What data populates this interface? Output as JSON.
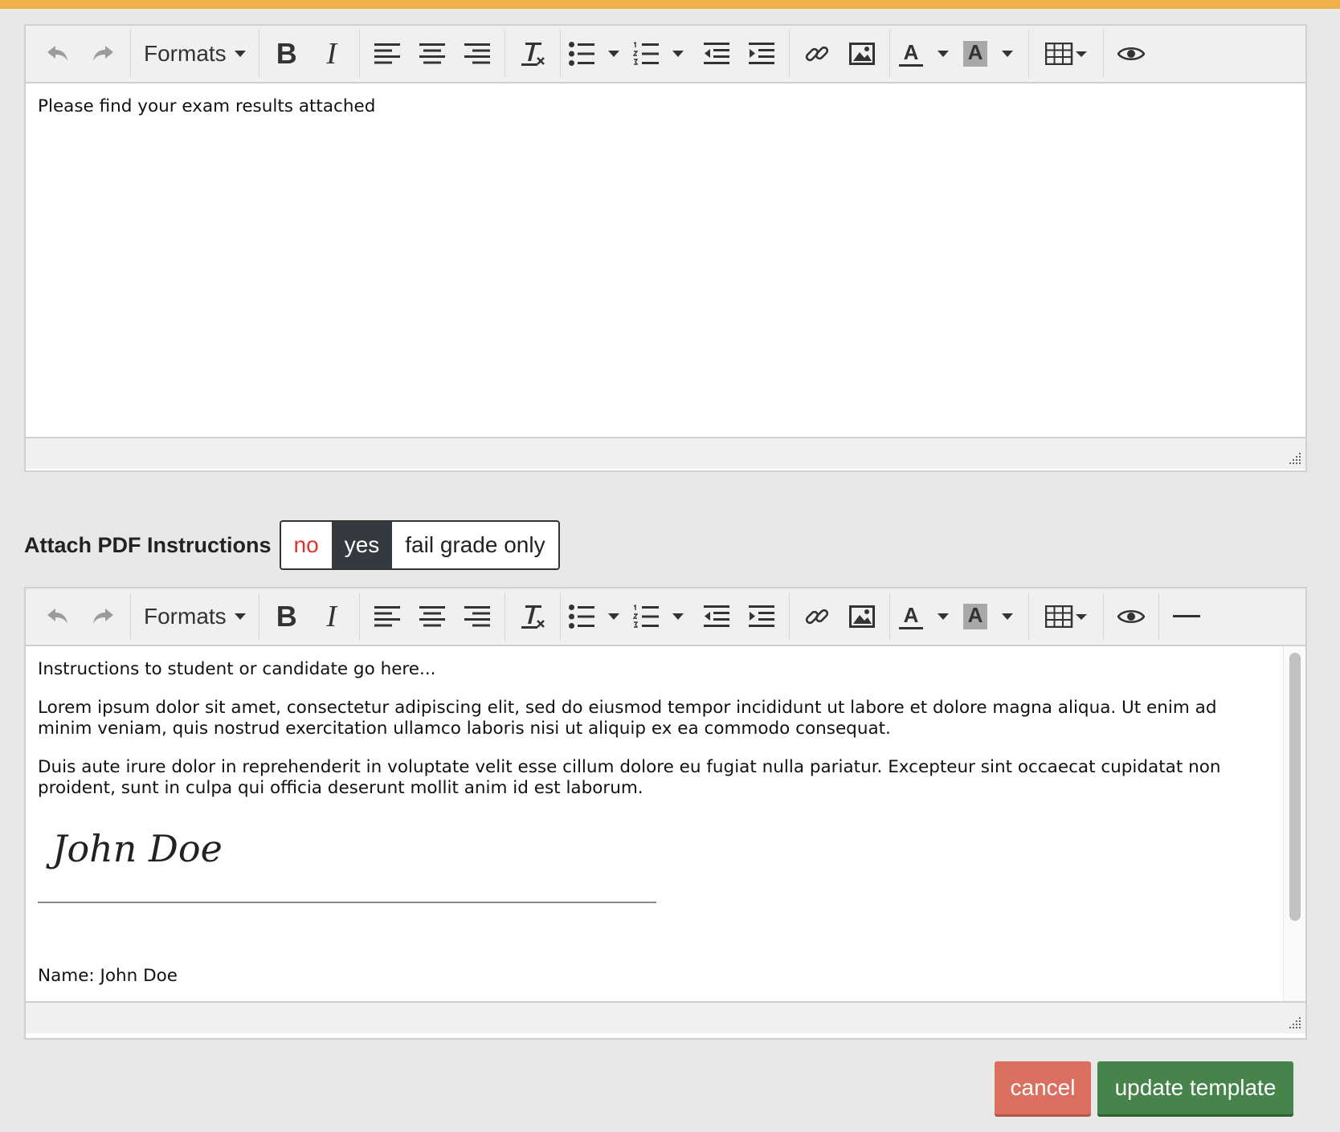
{
  "toolbar": {
    "formats_label": "Formats",
    "bold_glyph": "B",
    "italic_glyph": "I",
    "icons": [
      "undo-icon",
      "redo-icon",
      "bold-icon",
      "italic-icon",
      "align-left-icon",
      "align-center-icon",
      "align-right-icon",
      "clear-formatting-icon",
      "bullet-list-icon",
      "numbered-list-icon",
      "outdent-icon",
      "indent-icon",
      "link-icon",
      "image-icon",
      "text-color-icon",
      "background-color-icon",
      "table-icon",
      "preview-icon",
      "horizontal-rule-icon"
    ]
  },
  "editor1": {
    "body": "Please find your exam results attached"
  },
  "attach": {
    "label": "Attach PDF Instructions",
    "options": [
      "no",
      "yes",
      "fail grade only"
    ],
    "selected": "yes"
  },
  "editor2": {
    "intro": "Instructions to student or candidate go here...",
    "para1": "Lorem ipsum dolor sit amet, consectetur adipiscing elit, sed do eiusmod tempor incididunt ut labore et dolore magna aliqua. Ut enim ad minim veniam, quis nostrud exercitation ullamco laboris nisi ut aliquip ex ea commodo consequat.",
    "para2": "Duis aute irure dolor in reprehenderit in voluptate velit esse cillum dolore eu fugiat nulla pariatur. Excepteur sint occaecat cupidatat non proident, sunt in culpa qui officia deserunt mollit anim id est laborum.",
    "signature": "John Doe",
    "name_line": "Name: John Doe"
  },
  "actions": {
    "cancel": "cancel",
    "update": "update template"
  },
  "colors": {
    "top_bar": "#efb04c",
    "selected_segment": "#343a40",
    "no_option": "#e3322b",
    "cancel_button": "#db7060",
    "update_button": "#47844b"
  }
}
